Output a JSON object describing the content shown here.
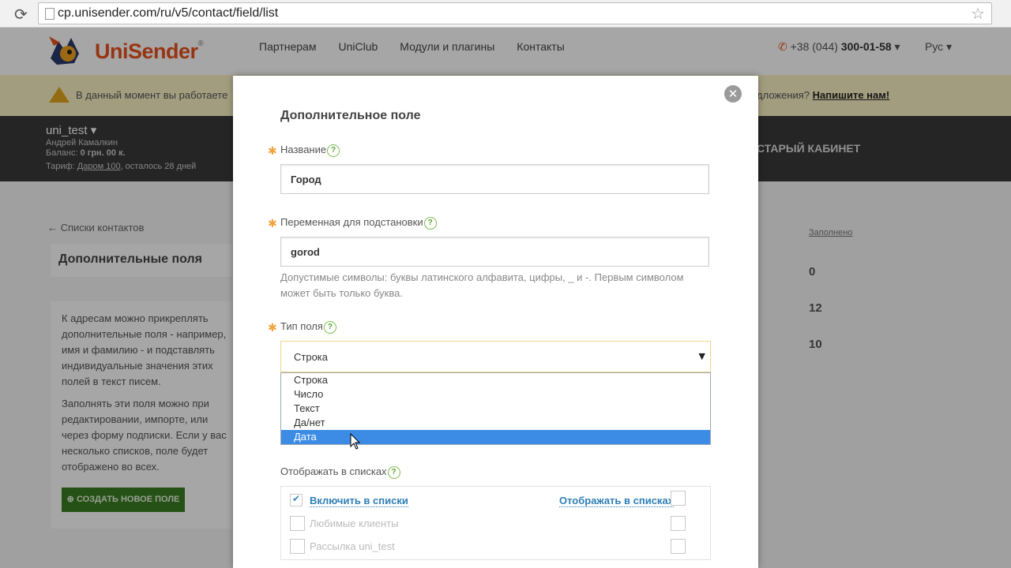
{
  "browser": {
    "url": "cp.unisender.com/ru/v5/contact/field/list"
  },
  "header": {
    "logo": "UniSender",
    "nav": [
      "Партнерам",
      "UniClub",
      "Модули и плагины",
      "Контакты"
    ],
    "phone_prefix": "+38 (044)",
    "phone_number": "300-01-58",
    "language": "Рус"
  },
  "warning": {
    "text": "В данный момент вы работаете",
    "right_text": "дложения?",
    "right_link": "Напишите нам!"
  },
  "account": {
    "username": "uni_test",
    "fullname": "Андрей Камалкин",
    "balance_label": "Баланс:",
    "balance_value": "0 грн. 00 к.",
    "tariff_label": "Тариф:",
    "tariff_value": "Даром 100",
    "tariff_rest": ", осталось 28 дней",
    "old_cabinet": "СТАРЫЙ КАБИНЕТ"
  },
  "page": {
    "back_link": "← Списки контактов",
    "title": "Дополнительные поля",
    "info_p1": "К адресам можно прикреплять дополнительные поля - например, имя и фамилию - и подставлять индивидуальные значения этих полей в текст писем.",
    "info_p2": "Заполнять эти поля можно при редактировании, импорте, или через форму подписки. Если у вас несколько списков, поле будет отображено во всех.",
    "create_button": "СОЗДАТЬ НОВОЕ ПОЛЕ",
    "column_header": "Заполнено",
    "counts": [
      "0",
      "12",
      "10"
    ]
  },
  "modal": {
    "title": "Дополнительное поле",
    "required_mark": "✱",
    "help_mark": "?",
    "name_label": "Название",
    "name_value": "Город",
    "var_label": "Переменная для подстановки",
    "var_value": "gorod",
    "var_hint": "Допустимые символы: буквы латинского алфавита, цифры, _ и -. Первым символом может быть только буква.",
    "type_label": "Тип поля",
    "type_selected": "Строка",
    "type_options": [
      "Строка",
      "Число",
      "Текст",
      "Да/нет",
      "Дата"
    ],
    "type_highlighted_index": 4,
    "lists_label": "Отображать в списках",
    "lists": [
      {
        "label": "Включить в списки",
        "checked": true
      },
      {
        "label": "Любимые клиенты",
        "checked": false
      },
      {
        "label": "Рассылка uni_test",
        "checked": false
      }
    ],
    "show_in_lists_label": "Отображать в списках"
  },
  "colors": {
    "brand": "#e8501c",
    "link": "#2e7fb5",
    "highlight": "#3c8ce6",
    "help": "#5aa131",
    "required": "#f2a23d"
  }
}
